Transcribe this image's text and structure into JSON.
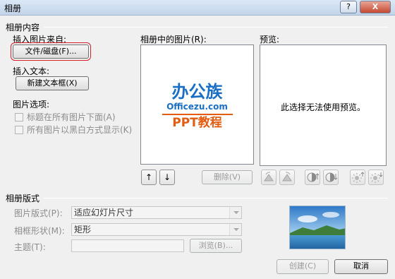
{
  "window": {
    "title": "相册",
    "help_label": "?",
    "close_label": "X"
  },
  "content_section": {
    "title": "相册内容",
    "insert_picture_from": "插入图片来自:",
    "file_disk_button": "文件/磁盘(F)...",
    "insert_text": "插入文本:",
    "new_textbox_button": "新建文本框(X)",
    "picture_options": "图片选项:",
    "captions_below_all": "标题在所有图片下面(A)",
    "all_pictures_bw": "所有图片以黑白方式显示(K)",
    "pictures_in_album": "相册中的图片(R):",
    "preview": "预览:",
    "preview_message": "此选择无法使用预览。",
    "remove_button": "删除(V)",
    "move_up_glyph": "↑",
    "move_down_glyph": "↓"
  },
  "logo": {
    "chinese": "办公族",
    "site": "Officezu.com",
    "tagline": "PPT教程"
  },
  "layout_section": {
    "title": "相册版式",
    "picture_layout_label": "图片版式(P):",
    "picture_layout_value": "适应幻灯片尺寸",
    "frame_shape_label": "相框形状(M):",
    "frame_shape_value": "矩形",
    "theme_label": "主题(T):",
    "browse_button": "浏览(B)..."
  },
  "footer": {
    "create_button": "创建(C)",
    "cancel_button": "取消"
  },
  "colors": {
    "accent_red": "#d4202a",
    "logo_blue": "#1a6fc4",
    "logo_orange": "#e45c10"
  },
  "icons": [
    "help-icon",
    "close-icon",
    "rotate-left-icon",
    "rotate-right-icon",
    "contrast-up-icon",
    "contrast-down-icon",
    "brightness-up-icon",
    "brightness-down-icon"
  ]
}
